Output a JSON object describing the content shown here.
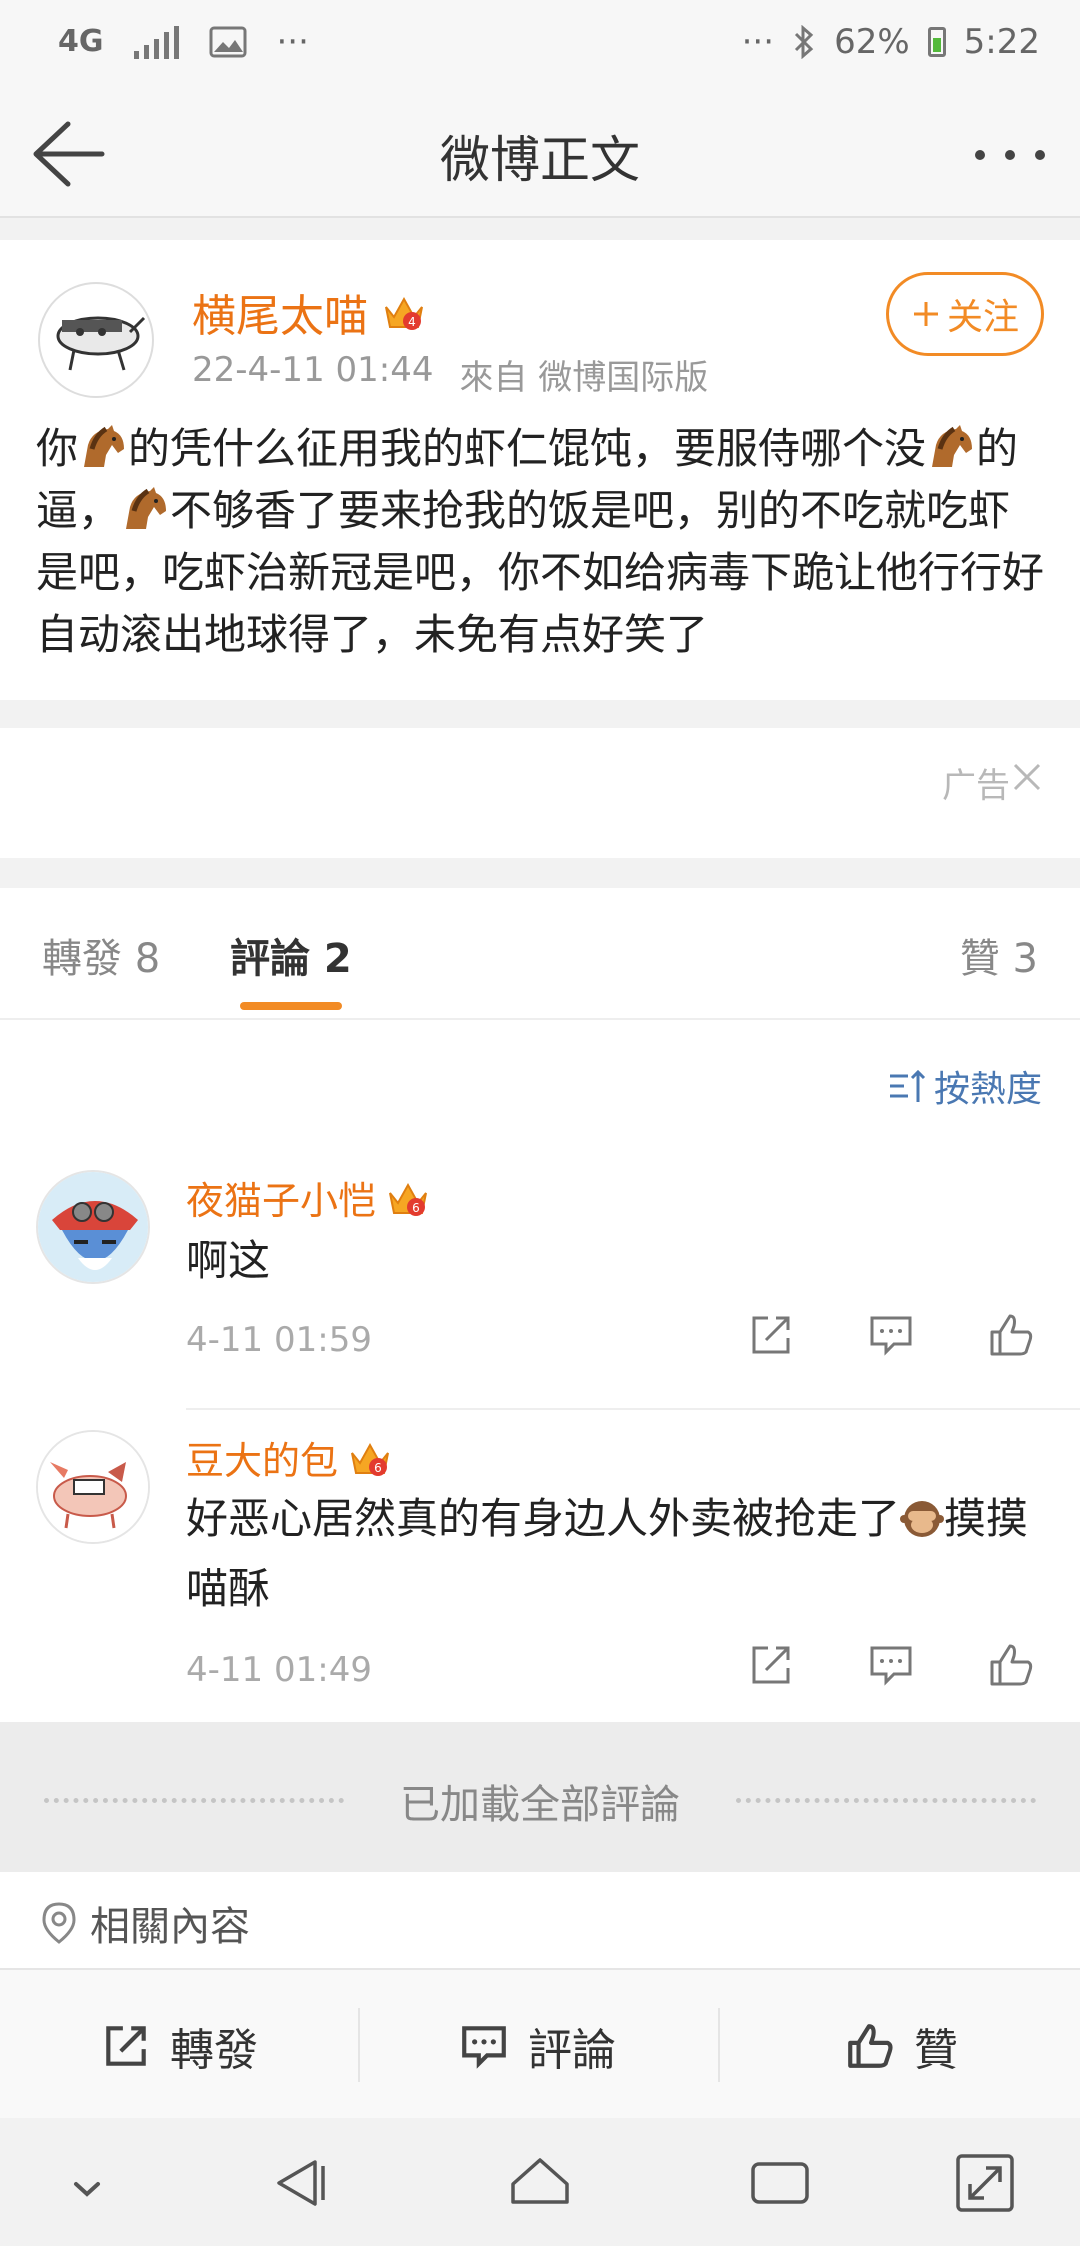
{
  "status_bar": {
    "network": "4G",
    "more_left": "···",
    "more_right": "···",
    "battery": "62%",
    "time": "5:22"
  },
  "nav": {
    "title": "微博正文"
  },
  "post": {
    "author": "横尾太喵",
    "date": "22-4-11 01:44",
    "source": "來自 微博国际版",
    "follow_label": "关注",
    "text_segments": [
      "你",
      "的凭什么征用我的虾仁馄饨，要服侍哪个没",
      "的逼，",
      "不够香了要来抢我的饭是吧，别的不吃就吃虾是吧，吃虾治新冠是吧，你不如给病毒下跪让他行行好自动滚出地球得了，未免有点好笑了"
    ],
    "emoji": "horse-emoji"
  },
  "ad": {
    "label": "广告"
  },
  "tabs": {
    "repost": "轉發 8",
    "comment": "評論 2",
    "like": "贊 3"
  },
  "comments": {
    "sort_label": "按熱度",
    "items": [
      {
        "name": "夜猫子小恺",
        "text": "啊这",
        "time": "4-11 01:59"
      },
      {
        "name": "豆大的包",
        "text": "好恶心居然真的有身边人外卖被抢走了",
        "text_tail": "摸摸喵酥",
        "time": "4-11 01:49"
      }
    ],
    "loaded_all": "已加載全部評論"
  },
  "related": {
    "label": "相關內容"
  },
  "toolbar": {
    "repost": "轉發",
    "comment": "評論",
    "like": "贊"
  },
  "colors": {
    "accent": "#f28b25",
    "name_orange": "#eb7314",
    "link_blue": "#4a78b2"
  }
}
